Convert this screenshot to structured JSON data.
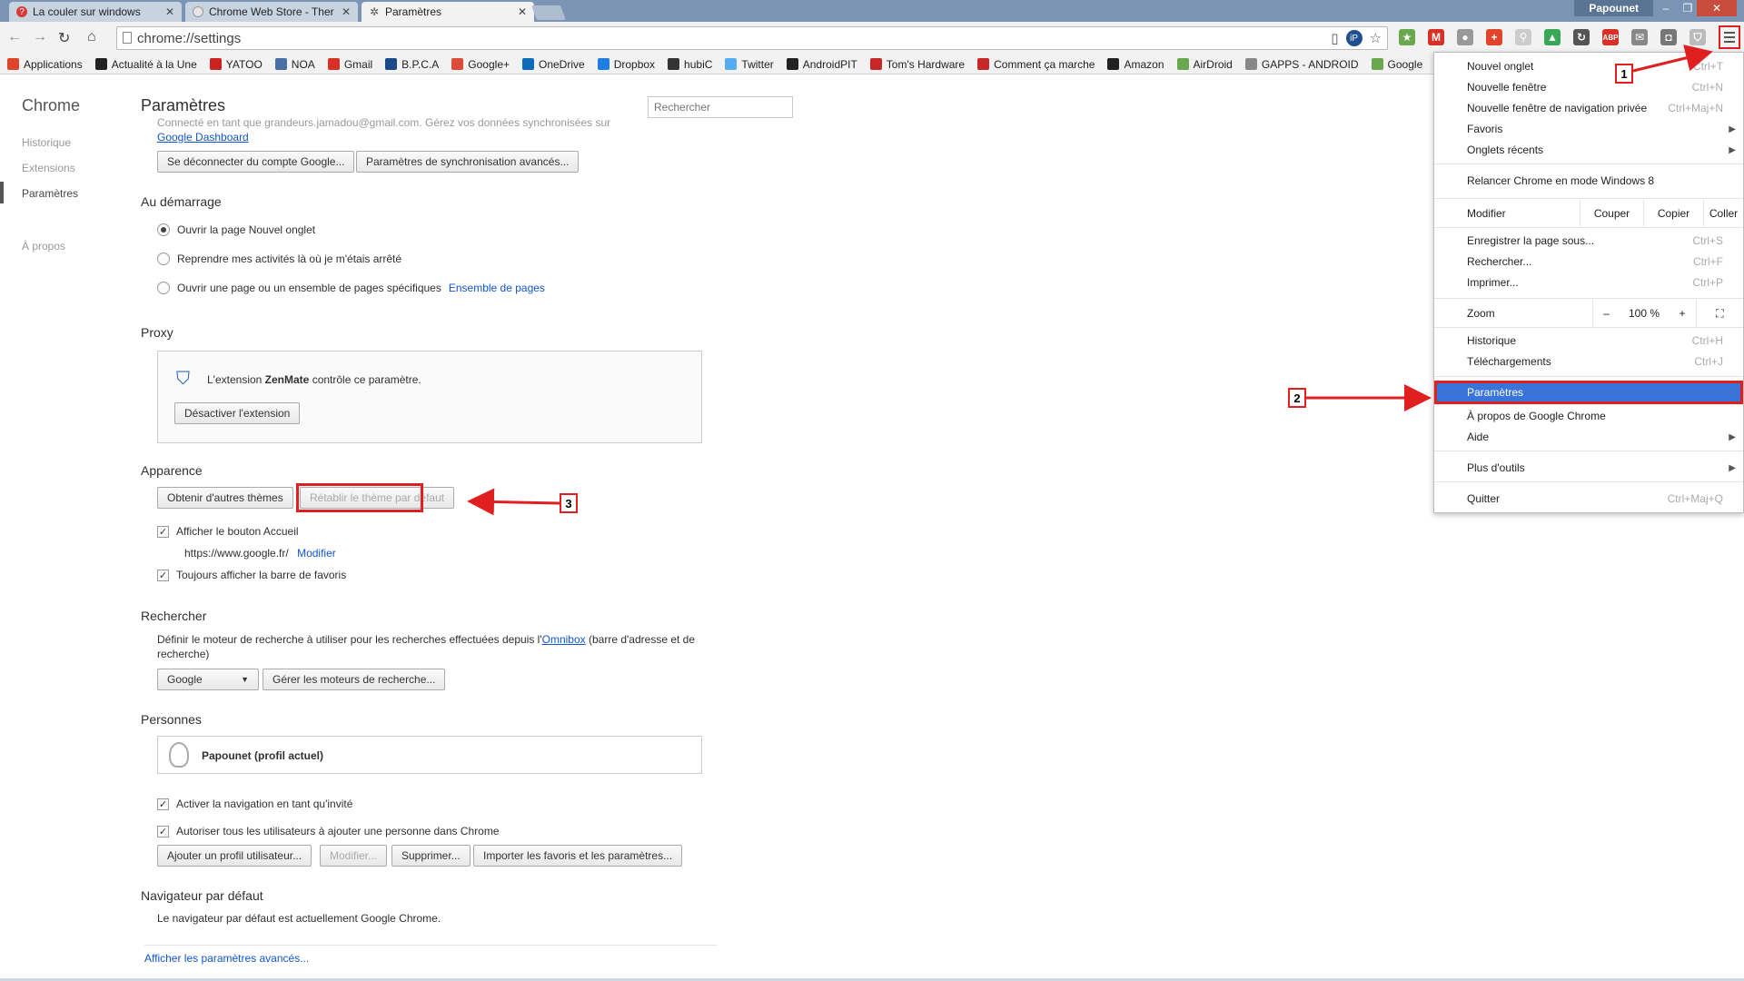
{
  "tabs": [
    {
      "title": "La couler sur windows",
      "icon": "question-icon",
      "active": false
    },
    {
      "title": "Chrome Web Store - Ther",
      "icon": "webstore-icon",
      "active": false
    },
    {
      "title": "Paramètres",
      "icon": "gear-icon",
      "active": true
    }
  ],
  "window": {
    "profile_name": "Papounet",
    "minimize": "–",
    "maximize": "❐",
    "close": "✕"
  },
  "toolbar": {
    "url": "chrome://settings"
  },
  "bookmarks": [
    {
      "label": "Applications",
      "color": "#e0452b"
    },
    {
      "label": "Actualité à la Une",
      "color": "#222222"
    },
    {
      "label": "YATOO",
      "color": "#cc2222"
    },
    {
      "label": "NOA",
      "color": "#4a6fa5"
    },
    {
      "label": "Gmail",
      "color": "#d93025"
    },
    {
      "label": "B.P.C.A",
      "color": "#1a4a8a"
    },
    {
      "label": "Google+",
      "color": "#dd4b39"
    },
    {
      "label": "OneDrive",
      "color": "#0f6cbd"
    },
    {
      "label": "Dropbox",
      "color": "#1f7fe0"
    },
    {
      "label": "hubiC",
      "color": "#333333"
    },
    {
      "label": "Twitter",
      "color": "#55acee"
    },
    {
      "label": "AndroidPIT",
      "color": "#222222"
    },
    {
      "label": "Tom's Hardware",
      "color": "#c62828"
    },
    {
      "label": "Comment ça marche",
      "color": "#c62828"
    },
    {
      "label": "Amazon",
      "color": "#222222"
    },
    {
      "label": "AirDroid",
      "color": "#6aa84f"
    },
    {
      "label": "GAPPS - ANDROID",
      "color": "#888888"
    },
    {
      "label": "Google",
      "color": "#6aa84f"
    }
  ],
  "sidebar": {
    "brand": "Chrome",
    "items": [
      {
        "label": "Historique"
      },
      {
        "label": "Extensions"
      },
      {
        "label": "Paramètres"
      },
      {
        "label": "À propos"
      }
    ]
  },
  "settings": {
    "title": "Paramètres",
    "search_placeholder": "Rechercher",
    "sync": {
      "faded_text": "Connecté en tant que grandeurs.jamadou@gmail.com. Gérez vos données synchronisées sur",
      "dashboard_link": "Google Dashboard",
      "disconnect_button": "Se déconnecter du compte Google...",
      "advanced_sync_button": "Paramètres de synchronisation avancés..."
    },
    "startup": {
      "title": "Au démarrage",
      "opt1": "Ouvrir la page Nouvel onglet",
      "opt2": "Reprendre mes activités là où je m'étais arrêté",
      "opt3": "Ouvrir une page ou un ensemble de pages spécifiques",
      "opt3_link": "Ensemble de pages"
    },
    "proxy": {
      "title": "Proxy",
      "text_pre": "L'extension ",
      "ext_name": "ZenMate",
      "text_post": " contrôle ce paramètre.",
      "disable_button": "Désactiver l'extension"
    },
    "appearance": {
      "title": "Apparence",
      "themes_button": "Obtenir d'autres thèmes",
      "reset_theme_button": "Rétablir le thème par défaut",
      "show_home": "Afficher le bouton Accueil",
      "home_url": "https://www.google.fr/",
      "home_modify": "Modifier",
      "show_bookmarks": "Toujours afficher la barre de favoris"
    },
    "search_section": {
      "title": "Rechercher",
      "desc_pre": "Définir le moteur de recherche à utiliser pour les recherches effectuées depuis l'",
      "desc_link": "Omnibox",
      "desc_post": " (barre d'adresse et de recherche)",
      "engine": "Google",
      "manage_button": "Gérer les moteurs de recherche..."
    },
    "people": {
      "title": "Personnes",
      "profile": "Papounet (profil actuel)",
      "guest": "Activer la navigation en tant qu'invité",
      "allow_add": "Autoriser tous les utilisateurs à ajouter une personne dans Chrome",
      "add_button": "Ajouter un profil utilisateur...",
      "modify_button": "Modifier...",
      "delete_button": "Supprimer...",
      "import_button": "Importer les favoris et les paramètres..."
    },
    "default_browser": {
      "title": "Navigateur par défaut",
      "text": "Le navigateur par défaut est actuellement Google Chrome."
    },
    "advanced_link": "Afficher les paramètres avancés..."
  },
  "menu": {
    "new_tab": {
      "label": "Nouvel onglet",
      "shortcut": "Ctrl+T"
    },
    "new_window": {
      "label": "Nouvelle fenêtre",
      "shortcut": "Ctrl+N"
    },
    "incognito": {
      "label": "Nouvelle fenêtre de navigation privée",
      "shortcut": "Ctrl+Maj+N"
    },
    "bookmarks": {
      "label": "Favoris"
    },
    "recent_tabs": {
      "label": "Onglets récents"
    },
    "win8": {
      "label": "Relancer Chrome en mode Windows 8"
    },
    "edit": {
      "label": "Modifier",
      "cut": "Couper",
      "copy": "Copier",
      "paste": "Coller"
    },
    "save_page": {
      "label": "Enregistrer la page sous...",
      "shortcut": "Ctrl+S"
    },
    "find": {
      "label": "Rechercher...",
      "shortcut": "Ctrl+F"
    },
    "print": {
      "label": "Imprimer...",
      "shortcut": "Ctrl+P"
    },
    "zoom": {
      "label": "Zoom",
      "minus": "–",
      "value": "100 %",
      "plus": "+"
    },
    "history": {
      "label": "Historique",
      "shortcut": "Ctrl+H"
    },
    "downloads": {
      "label": "Téléchargements",
      "shortcut": "Ctrl+J"
    },
    "settings": {
      "label": "Paramètres"
    },
    "about": {
      "label": "À propos de Google Chrome"
    },
    "help": {
      "label": "Aide"
    },
    "more_tools": {
      "label": "Plus d'outils"
    },
    "quit": {
      "label": "Quitter",
      "shortcut": "Ctrl+Maj+Q"
    }
  },
  "annotations": {
    "step1": "1",
    "step2": "2",
    "step3": "3",
    "color": "#e02020"
  }
}
